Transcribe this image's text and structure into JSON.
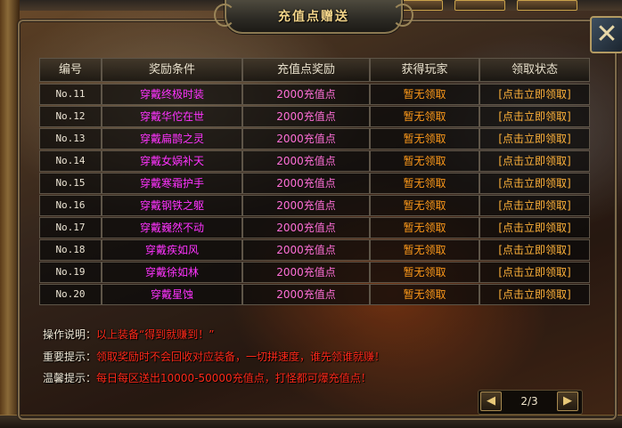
{
  "window": {
    "title": "充值点赠送",
    "close_label": "✕"
  },
  "table": {
    "headers": [
      "编号",
      "奖励条件",
      "充值点奖励",
      "获得玩家",
      "领取状态"
    ],
    "rows": [
      {
        "id": "No.11",
        "condition": "穿戴终极时装",
        "reward": "2000充值点",
        "player": "暂无领取",
        "status": "[点击立即领取]"
      },
      {
        "id": "No.12",
        "condition": "穿戴华佗在世",
        "reward": "2000充值点",
        "player": "暂无领取",
        "status": "[点击立即领取]"
      },
      {
        "id": "No.13",
        "condition": "穿戴扁鹊之灵",
        "reward": "2000充值点",
        "player": "暂无领取",
        "status": "[点击立即领取]"
      },
      {
        "id": "No.14",
        "condition": "穿戴女娲补天",
        "reward": "2000充值点",
        "player": "暂无领取",
        "status": "[点击立即领取]"
      },
      {
        "id": "No.15",
        "condition": "穿戴寒霜护手",
        "reward": "2000充值点",
        "player": "暂无领取",
        "status": "[点击立即领取]"
      },
      {
        "id": "No.16",
        "condition": "穿戴钢铁之躯",
        "reward": "2000充值点",
        "player": "暂无领取",
        "status": "[点击立即领取]"
      },
      {
        "id": "No.17",
        "condition": "穿戴巍然不动",
        "reward": "2000充值点",
        "player": "暂无领取",
        "status": "[点击立即领取]"
      },
      {
        "id": "No.18",
        "condition": "穿戴疾如风",
        "reward": "2000充值点",
        "player": "暂无领取",
        "status": "[点击立即领取]"
      },
      {
        "id": "No.19",
        "condition": "穿戴徐如林",
        "reward": "2000充值点",
        "player": "暂无领取",
        "status": "[点击立即领取]"
      },
      {
        "id": "No.20",
        "condition": "穿戴星蚀",
        "reward": "2000充值点",
        "player": "暂无领取",
        "status": "[点击立即领取]"
      }
    ]
  },
  "notes": [
    {
      "label": "操作说明：",
      "value": "以上装备“得到就赚到！”"
    },
    {
      "label": "重要提示：",
      "value": "领取奖励时不会回收对应装备，一切拼速度，谁先领谁就赚！"
    },
    {
      "label": "温馨提示：",
      "value": "每日每区送出10000-50000充值点，打怪都可爆充值点！"
    }
  ],
  "pager": {
    "text": "2/3",
    "prev": "◀",
    "next": "▶"
  },
  "colors": {
    "condition": "#ff33ff",
    "reward": "#ff6fd8",
    "player": "#ff9a1a",
    "warning": "#ff2a1a",
    "title": "#f3d58a"
  }
}
